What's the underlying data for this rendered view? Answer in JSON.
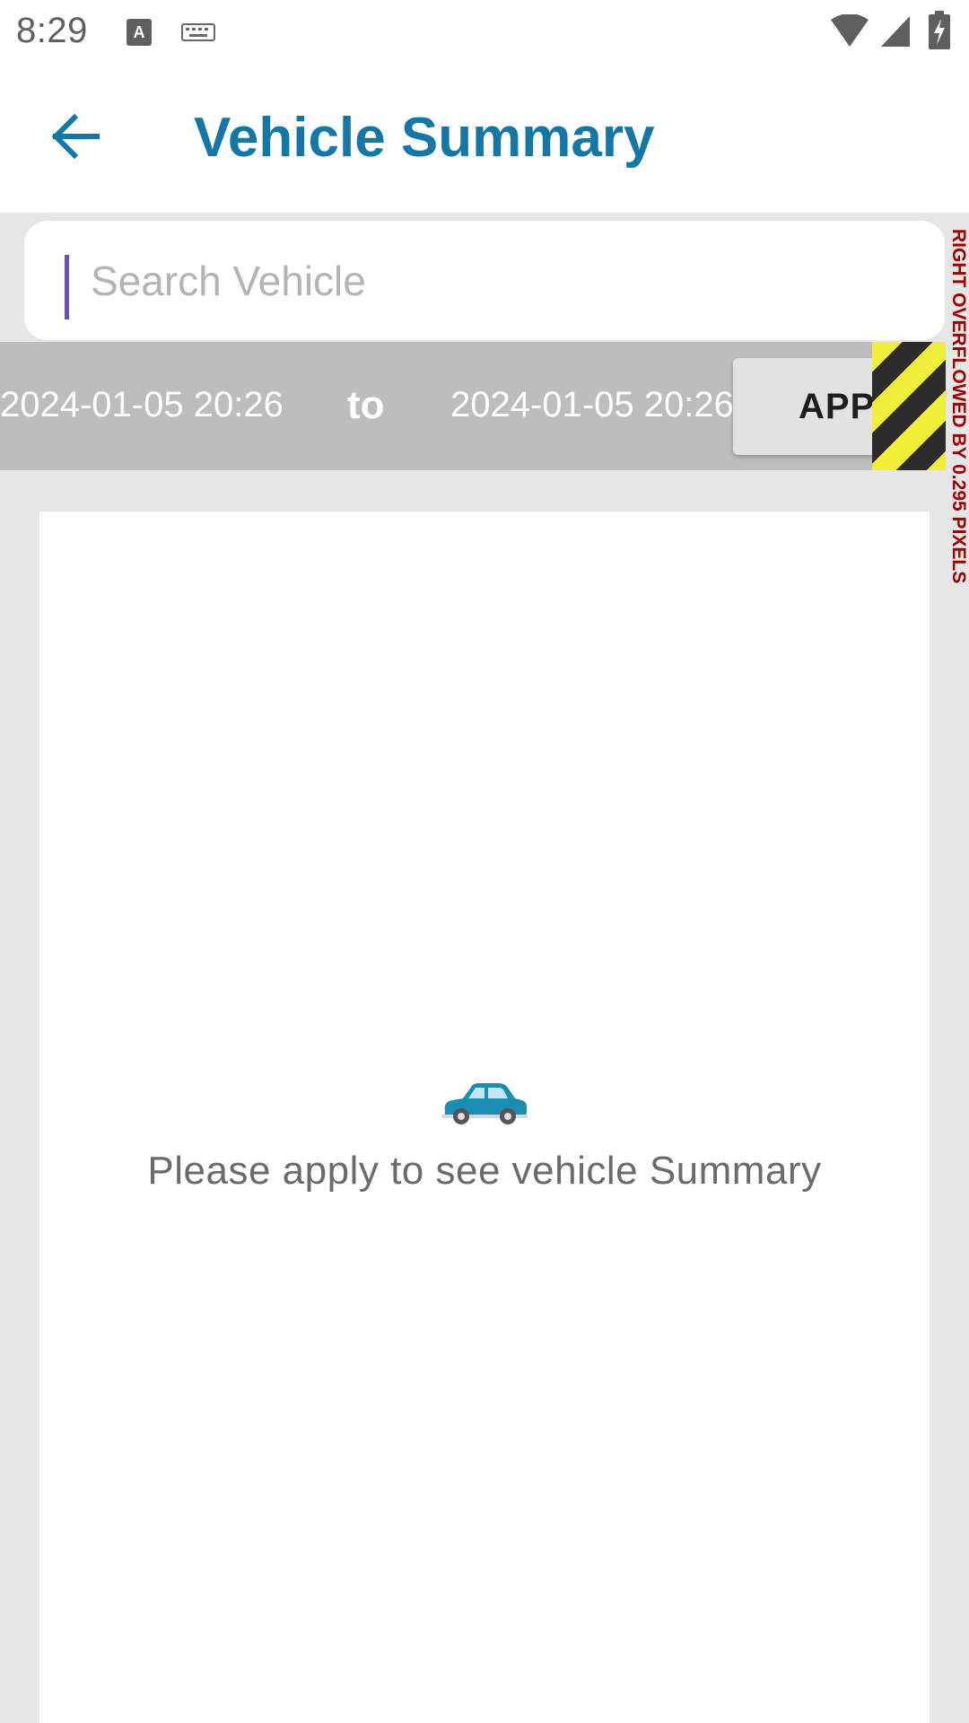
{
  "status_bar": {
    "time": "8:29",
    "icons": [
      "keyboard-a-icon",
      "keyboard-icon",
      "wifi-icon",
      "signal-icon",
      "battery-charging-icon"
    ]
  },
  "header": {
    "title": "Vehicle Summary",
    "back_icon": "arrow-back-icon",
    "accent_color": "#1577a5"
  },
  "search": {
    "placeholder": "Search Vehicle",
    "value": ""
  },
  "date_range": {
    "from": "2024-01-05 20:26",
    "separator": "to",
    "to": "2024-01-05 20:26",
    "apply_label": "APPLY"
  },
  "overflow_warning": {
    "text": "RIGHT OVERFLOWED BY 0.295 PIXELS"
  },
  "empty_state": {
    "icon": "car-icon",
    "message": "Please apply to see vehicle Summary"
  }
}
